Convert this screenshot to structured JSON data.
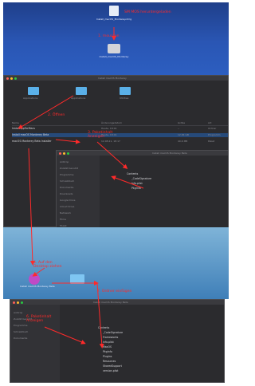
{
  "annotations": {
    "note_downloaded": "SM MOS heruntergeladen",
    "note_mount": "1.  mounten",
    "note_open": "2. Öffnen",
    "note_show_package": "3. Paketinhalt Anzeigen",
    "note_copy_desktop": "4. Auf den Desktop ziehen",
    "note_show_package_2": "6. Paketinhalt Anzeigen",
    "note_insert_folder": "7. Ordner einfügen"
  },
  "desktop": {
    "dmg_label_1": "Install_macOS_Monterey.dmg",
    "disk_label_1": "Install_macOS_Monterey"
  },
  "finder1": {
    "title": "Install macOS Monterey",
    "folders": [
      "Applications",
      "Applications",
      "Utilities"
    ],
    "columns": [
      "Name",
      "Änderungsdatum",
      "Größe",
      "Art"
    ],
    "rows": [
      {
        "name": "InstallAppForMacs",
        "date": "Heute, 18:01",
        "size": "--",
        "kind": "Ordner"
      },
      {
        "name": "Install macOS Monterey Beta",
        "date": "Heute, 18:01",
        "size": "12,84 GB",
        "kind": "Programm"
      },
      {
        "name": "macOS Monterey Beta Installer",
        "date": "12.08.21, 18:17",
        "size": "40,6 MB",
        "kind": "Paket"
      }
    ]
  },
  "finder2": {
    "title": "Install macOS Monterey Beta",
    "sidebar": [
      "AirDrop",
      "Zuletzt benutzt",
      "Programme",
      "Schreibtisch",
      "Dokumente",
      "Downloads",
      "Google Drive",
      "iCloud Drive",
      "Netzwerk",
      "Filme",
      "Musik",
      "Bilder"
    ],
    "items": [
      "Contents",
      "_CodeSignature",
      "Info.plist",
      "PkgInfo"
    ]
  },
  "finder3": {
    "title": "Install macOS Monterey Beta",
    "sidebar": [
      "AirDrop",
      "Zuletzt benutzt",
      "Programme",
      "Schreibtisch",
      "Dokumente"
    ],
    "items": [
      "Contents",
      "_CodeSignature",
      "Frameworks",
      "Info.plist",
      "MacOS",
      "PkgInfo",
      "Plugins",
      "Resources",
      "SharedSupport",
      "version.plist"
    ]
  },
  "desktop_icon": {
    "label": "Install macOS Monterey Beta"
  }
}
